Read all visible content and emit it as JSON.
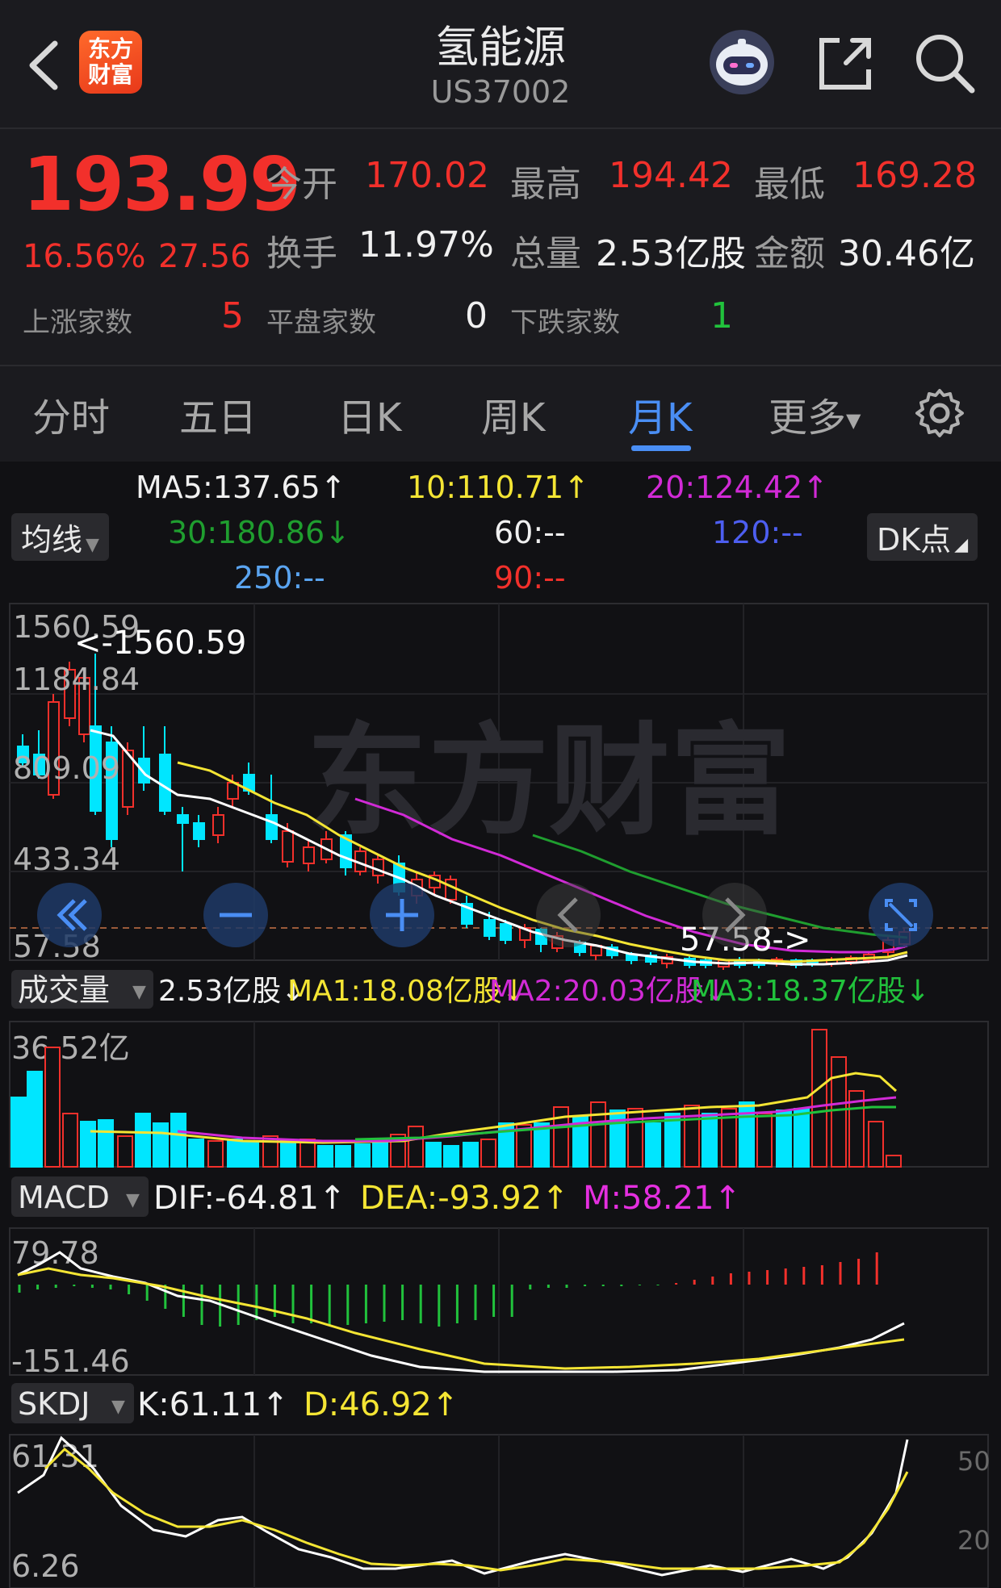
{
  "header": {
    "title": "氢能源",
    "code": "US37002",
    "logo_text_top": "东方",
    "logo_text_bottom": "财富"
  },
  "quote": {
    "price": "193.99",
    "change_pct": "16.56%",
    "change_amt": "27.56",
    "open_label": "今开",
    "open": "170.02",
    "high_label": "最高",
    "high": "194.42",
    "low_label": "最低",
    "low": "169.28",
    "turnover_label": "换手",
    "turnover": "11.97%",
    "volume_label": "总量",
    "volume": "2.53亿股",
    "amount_label": "金额",
    "amount": "30.46亿",
    "up_label": "上涨家数",
    "up": "5",
    "flat_label": "平盘家数",
    "flat": "0",
    "down_label": "下跌家数",
    "down": "1"
  },
  "tabs": [
    "分时",
    "五日",
    "日K",
    "周K",
    "月K",
    "更多"
  ],
  "active_tab": "月K",
  "ma_panel": {
    "ma5": "MA5:137.65↑",
    "ma10": "10:110.71↑",
    "ma20": "20:124.42↑",
    "ma30": "30:180.86↓",
    "ma60": "60:--",
    "ma120": "120:--",
    "ma250": "250:--",
    "ma90": "90:--",
    "selector": "均线",
    "dk": "DK点"
  },
  "kline": {
    "y_labels": [
      "1560.59",
      "1184.84",
      "809.09",
      "433.34",
      "57.58"
    ],
    "max_marker": "<-1560.59",
    "min_marker": "57.58->",
    "watermark": "东方财富"
  },
  "volume": {
    "selector": "成交量",
    "vol": "2.53亿股↓",
    "ma1": "MA1:18.08亿股↓",
    "ma2": "MA2:20.03亿股↓",
    "ma3": "MA3:18.37亿股↓",
    "y_label": "36.52亿"
  },
  "macd": {
    "selector": "MACD",
    "dif": "DIF:-64.81↑",
    "dea": "DEA:-93.92↑",
    "m": "M:58.21↑",
    "y_top": "79.78",
    "y_bottom": "-151.46"
  },
  "skdj": {
    "selector": "SKDJ",
    "k": "K:61.11↑",
    "d": "D:46.92↑",
    "y_top": "61.31",
    "y_bottom": "6.26",
    "r50": "50",
    "r20": "20"
  },
  "colors": {
    "up": "#f2302b",
    "down": "#21c23c",
    "accent": "#4a8ef4",
    "ma5": "#ffffff",
    "ma10": "#f4e534",
    "ma20": "#d12ad6",
    "ma30": "#1f9e2f"
  }
}
